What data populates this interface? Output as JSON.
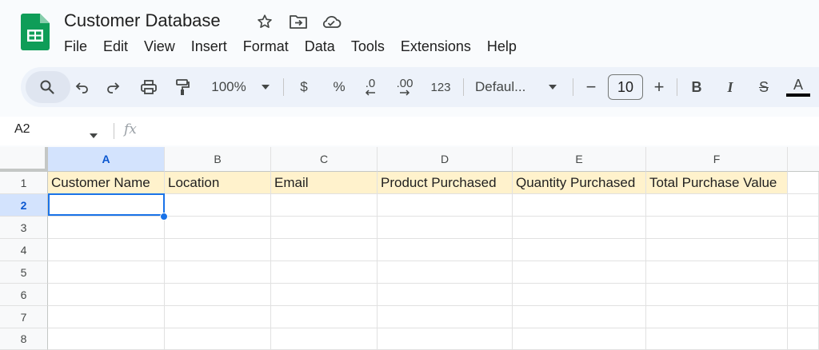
{
  "app": {
    "title": "Customer Database"
  },
  "menu": [
    "File",
    "Edit",
    "View",
    "Insert",
    "Format",
    "Data",
    "Tools",
    "Extensions",
    "Help"
  ],
  "toolbar": {
    "zoom": "100%",
    "currency": "$",
    "percent": "%",
    "decrease_decimal": ".0",
    "increase_decimal": ".00",
    "number_format": "123",
    "font": "Defaul...",
    "font_size": "10",
    "minus": "−",
    "plus": "+",
    "bold": "B",
    "italic": "I",
    "strike": "S",
    "text_color": "A"
  },
  "formula_bar": {
    "cell_ref": "A2",
    "fx": "fx",
    "value": ""
  },
  "grid": {
    "columns": [
      "A",
      "B",
      "C",
      "D",
      "E",
      "F"
    ],
    "rows": [
      "1",
      "2",
      "3",
      "4",
      "5",
      "6",
      "7",
      "8"
    ],
    "selected_cell": "A2",
    "header_row": [
      "Customer Name",
      "Location",
      "Email",
      "Product Purchased",
      "Quantity Purchased",
      "Total Purchase Value"
    ]
  },
  "colors": {
    "accent": "#1a73e8",
    "header_fill": "#fff2cc",
    "selected_header": "#d3e3fd",
    "logo_green": "#0f9d58"
  }
}
